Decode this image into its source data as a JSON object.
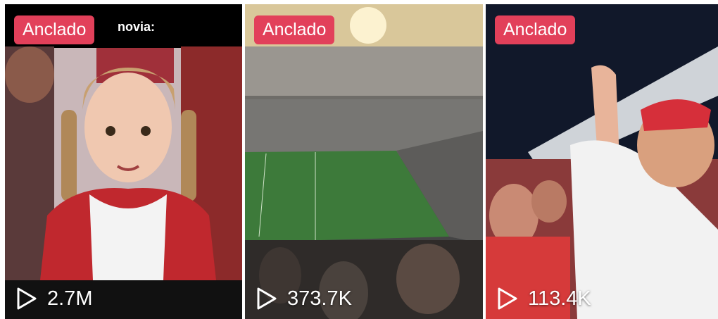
{
  "tiles": [
    {
      "badge": "Anclado",
      "views": "2.7M",
      "caption": "novia:",
      "icon": "play-icon"
    },
    {
      "badge": "Anclado",
      "views": "373.7K",
      "icon": "play-icon"
    },
    {
      "badge": "Anclado",
      "views": "113.4K",
      "icon": "play-icon"
    }
  ],
  "colors": {
    "badge_bg": "#e2405a",
    "text": "#ffffff"
  }
}
